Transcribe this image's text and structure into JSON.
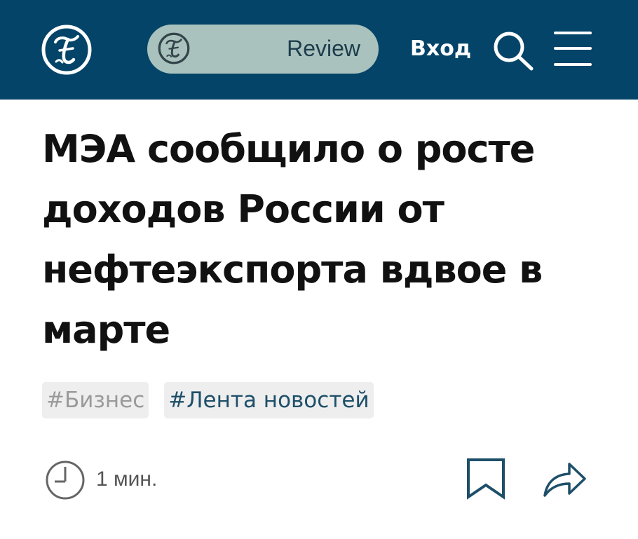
{
  "header": {
    "background_color": "#044468",
    "logo_icon": "newspaper-logo-icon",
    "review": {
      "label": "Review",
      "icon": "newspaper-logo-icon",
      "pill_color": "#a9c2bd"
    },
    "login_label": "Вход",
    "search_icon": "search-icon",
    "menu_icon": "hamburger-menu-icon"
  },
  "article": {
    "title": "МЭА сообщило о росте доходов России от нефтеэкспорта вдвое в марте",
    "tags": [
      {
        "label": "#Бизнес",
        "color": "#9a9a9a"
      },
      {
        "label": "#Лента новостей",
        "color": "#1e4f69"
      }
    ],
    "meta": {
      "clock_icon": "clock-icon",
      "read_time": "1 мин.",
      "bookmark_icon": "bookmark-icon",
      "share_icon": "share-arrow-icon"
    }
  }
}
